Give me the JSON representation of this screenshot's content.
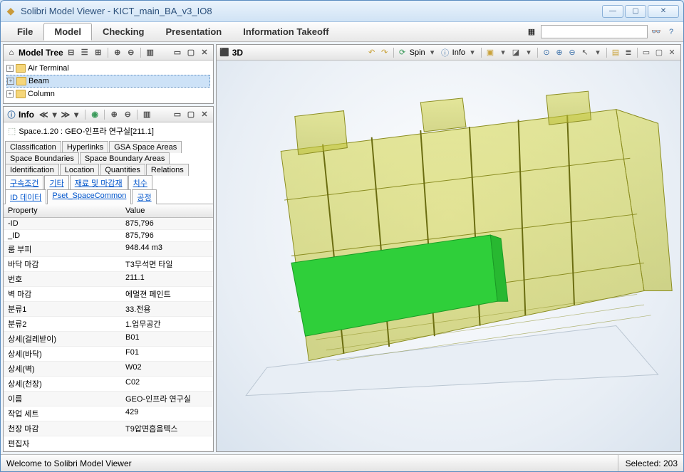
{
  "window": {
    "title": "Solibri Model Viewer - KICT_main_BA_v3_IO8"
  },
  "menu": {
    "tabs": [
      "File",
      "Model",
      "Checking",
      "Presentation",
      "Information Takeoff"
    ],
    "active_index": 1
  },
  "model_tree": {
    "title": "Model Tree",
    "items": [
      "Air Terminal",
      "Beam",
      "Column"
    ],
    "selected_index": 1
  },
  "info": {
    "title": "Info",
    "item": "Space.1.20 : GEO-인프라 연구실[211.1]",
    "tabs_row1": [
      "Classification",
      "Hyperlinks",
      "GSA Space Areas"
    ],
    "tabs_row2": [
      "Space Boundaries",
      "Space Boundary Areas"
    ],
    "tabs_row3": [
      "Identification",
      "Location",
      "Quantities",
      "Relations"
    ],
    "tabs_row4": [
      "구속조건",
      "기타",
      "재료 및 마감재",
      "치수"
    ],
    "tabs_row5": [
      "ID 데이터",
      "Pset_SpaceCommon",
      "공정"
    ],
    "active_tab": "ID 데이터",
    "columns": {
      "property": "Property",
      "value": "Value"
    },
    "rows": [
      {
        "p": "-ID",
        "v": "875,796"
      },
      {
        "p": "_ID",
        "v": "875,796"
      },
      {
        "p": "룸 부피",
        "v": "948.44 m3"
      },
      {
        "p": "바닥 마감",
        "v": "T3무석면 타일"
      },
      {
        "p": "번호",
        "v": "211.1"
      },
      {
        "p": "벽 마감",
        "v": "에멀젼 페인트"
      },
      {
        "p": "분류1",
        "v": "33.전용"
      },
      {
        "p": "분류2",
        "v": "1.업무공간"
      },
      {
        "p": "상세(걸레받이)",
        "v": "B01"
      },
      {
        "p": "상세(바닥)",
        "v": "F01"
      },
      {
        "p": "상세(벽)",
        "v": "W02"
      },
      {
        "p": "상세(천장)",
        "v": "C02"
      },
      {
        "p": "이름",
        "v": "GEO-인프라 연구실"
      },
      {
        "p": "작업 세트",
        "v": "429"
      },
      {
        "p": "천장 마감",
        "v": "T9압면흡음텍스"
      },
      {
        "p": "편집자",
        "v": ""
      }
    ]
  },
  "viewport": {
    "title": "3D",
    "spin_label": "Spin",
    "info_label": "Info"
  },
  "status": {
    "left": "Welcome to Solibri Model Viewer",
    "right": "Selected: 203"
  }
}
